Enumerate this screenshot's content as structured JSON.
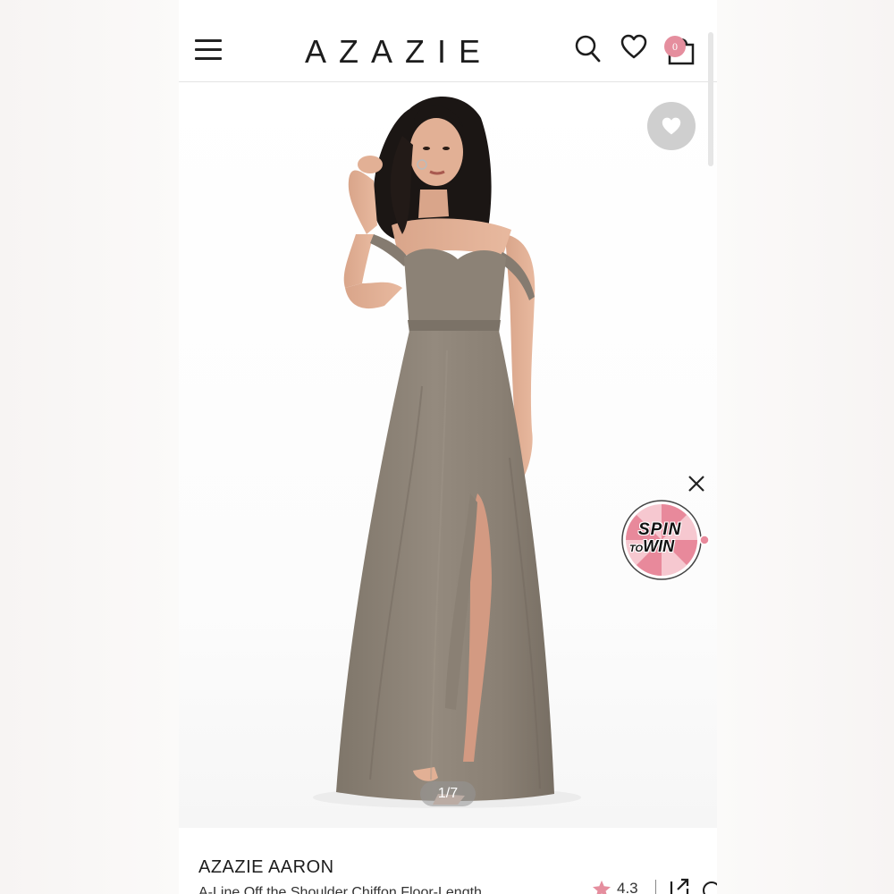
{
  "header": {
    "logo": "AZAZIE",
    "cart_count": "0"
  },
  "icons": {
    "menu": "hamburger-menu-icon",
    "search": "search-icon",
    "wishlist": "heart-icon",
    "cart": "shopping-bag-icon",
    "favorite": "heart-filled-icon",
    "close": "close-icon",
    "rating": "star-icon",
    "share": "share-icon"
  },
  "gallery": {
    "pager": "1/7"
  },
  "promo": {
    "spin_line1": "SPIN",
    "spin_to": "TO",
    "spin_win": "WIN"
  },
  "product": {
    "name": "AZAZIE AARON",
    "subtitle": "A-Line Off the Shoulder Chiffon Floor-Length",
    "rating": "4.3"
  },
  "colors": {
    "accent_pink": "#e58e9e",
    "dress": "#8f8578",
    "text_dark": "#1d1d1d"
  }
}
